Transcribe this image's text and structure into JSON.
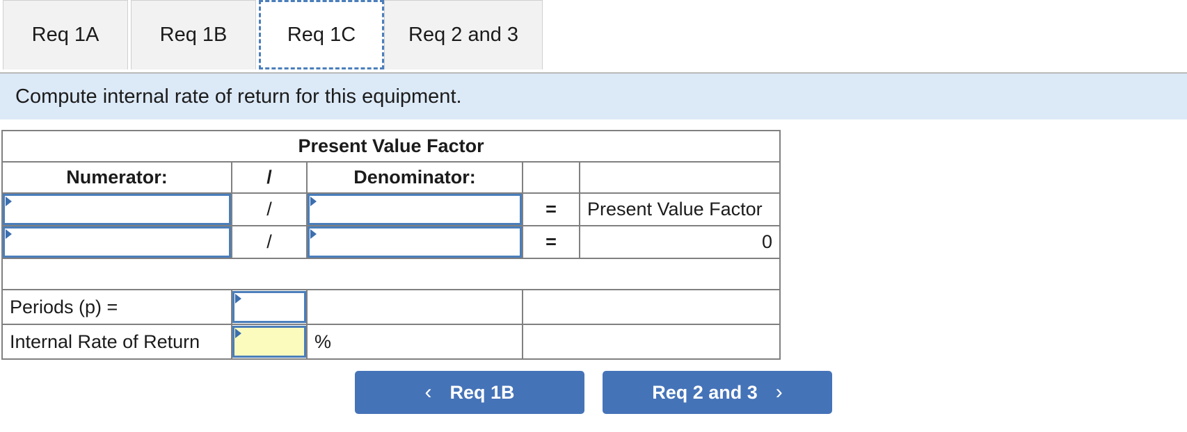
{
  "tabs": [
    {
      "label": "Req 1A",
      "active": false
    },
    {
      "label": "Req 1B",
      "active": false
    },
    {
      "label": "Req 1C",
      "active": true
    },
    {
      "label": "Req 2 and 3",
      "active": false
    }
  ],
  "instruction": "Compute internal rate of return for this equipment.",
  "worksheet": {
    "title": "Present Value Factor",
    "columns": {
      "numerator": "Numerator:",
      "operator": "/",
      "denominator": "Denominator:",
      "equals_col": "",
      "result_col": ""
    },
    "rows": [
      {
        "numerator_value": "",
        "operator": "/",
        "denominator_value": "",
        "equals": "=",
        "result": "Present Value Factor"
      },
      {
        "numerator_value": "",
        "operator": "/",
        "denominator_value": "",
        "equals": "=",
        "result": "0"
      }
    ],
    "periods_label": "Periods (p) =",
    "periods_value": "",
    "irr_label": "Internal Rate of Return",
    "irr_value": "",
    "percent_symbol": "%"
  },
  "nav": {
    "prev_label": "Req 1B",
    "prev_icon": "chevron-left-icon",
    "prev_chevron": "‹",
    "next_label": "Req 2 and 3",
    "next_icon": "chevron-right-icon",
    "next_chevron": "›"
  },
  "colors": {
    "header_blue": "#85ace2",
    "banner_blue": "#dce9f7",
    "button_blue": "#4573b8",
    "input_border_blue": "#4a7ebb",
    "input_highlight_yellow": "#fbfbbe",
    "grid_gray": "#808080"
  }
}
